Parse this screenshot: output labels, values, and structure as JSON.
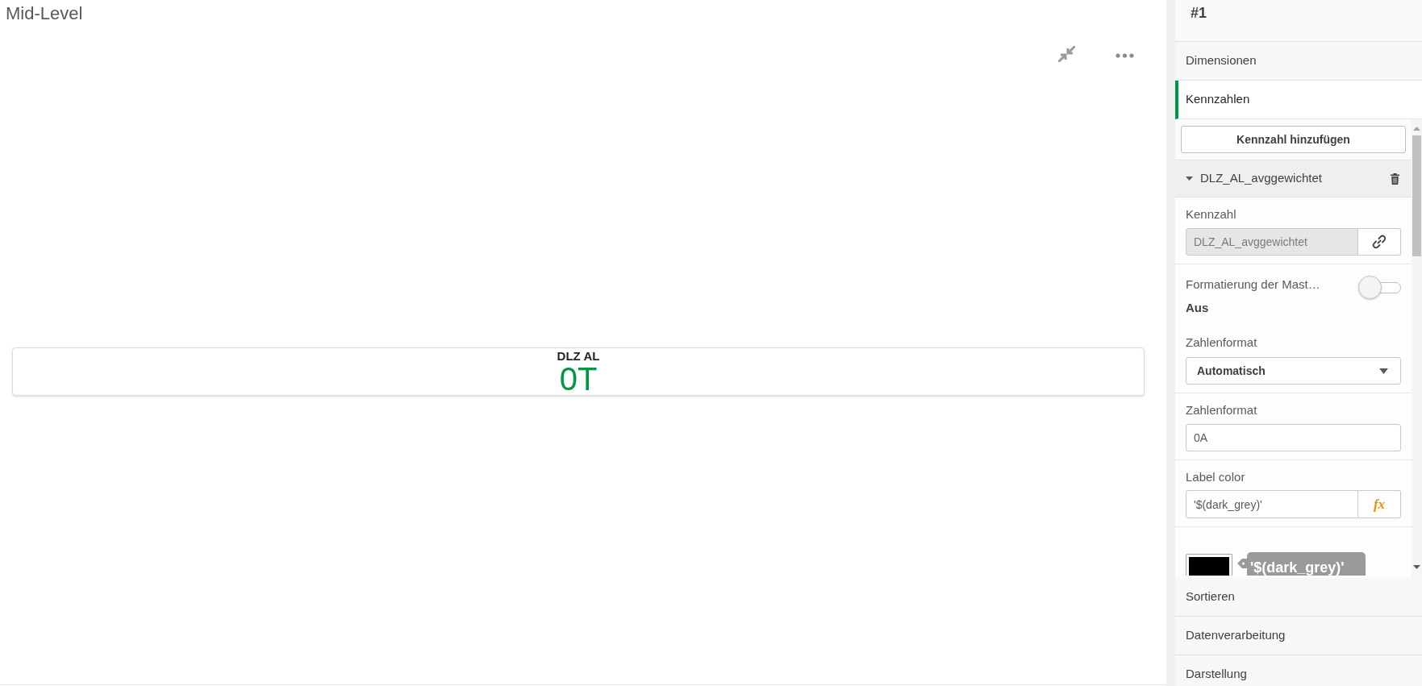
{
  "sheet": {
    "title": "Mid-Level"
  },
  "kpi": {
    "label": "DLZ AL",
    "value": "0T"
  },
  "panel": {
    "header": "#1",
    "sections": [
      {
        "label": "Dimensionen",
        "selected": false
      },
      {
        "label": "Kennzahlen",
        "selected": true
      },
      {
        "label": "Sortieren",
        "selected": false
      },
      {
        "label": "Datenverarbeitung",
        "selected": false
      },
      {
        "label": "Darstellung",
        "selected": false
      }
    ],
    "add_button": "Kennzahl hinzufügen",
    "measure": {
      "title": "DLZ_AL_avggewichtet",
      "expanded": true,
      "groups": [
        {
          "fields": [
            {
              "kind": "linked",
              "label": "Kennzahl",
              "value": "DLZ_AL_avggewichtet",
              "disabled": true
            }
          ]
        },
        {
          "fields": [
            {
              "kind": "toggle",
              "label": "Formatierung der Mast…",
              "state_text": "Aus",
              "on": false
            },
            {
              "kind": "dropdown",
              "label": "Zahlenformat",
              "value": "Automatisch"
            }
          ]
        },
        {
          "fields": [
            {
              "kind": "text",
              "label": "Zahlenformat",
              "value": "0A"
            }
          ]
        },
        {
          "fields": [
            {
              "kind": "expression",
              "label": "Label color",
              "value": "'$(dark_grey)'",
              "button": "fx"
            }
          ]
        },
        {
          "fields": [
            {
              "kind": "color",
              "color": "#000000",
              "tooltip": "'$(dark_grey)'"
            }
          ]
        }
      ]
    }
  }
}
